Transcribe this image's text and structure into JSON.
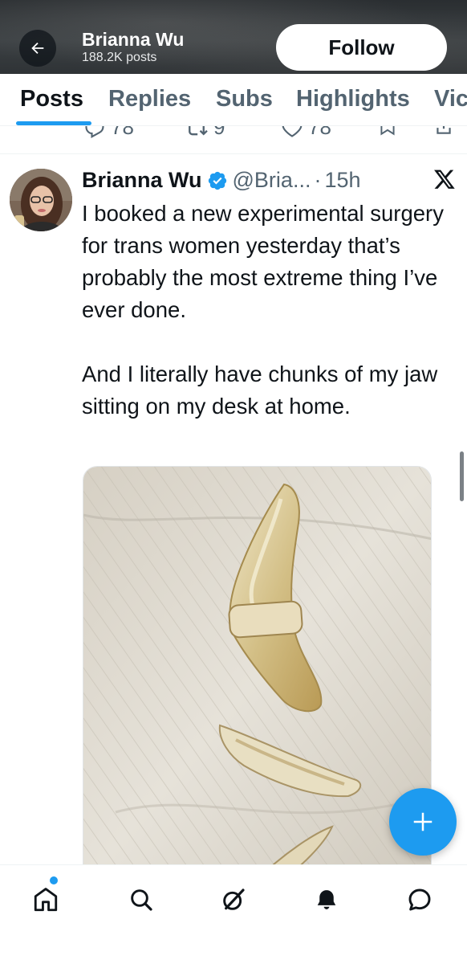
{
  "header": {
    "name": "Brianna Wu",
    "posts_count": "188.2K posts",
    "follow_label": "Follow"
  },
  "tabs": [
    {
      "label": "Posts",
      "active": true
    },
    {
      "label": "Replies",
      "active": false
    },
    {
      "label": "Subs",
      "active": false
    },
    {
      "label": "Highlights",
      "active": false
    },
    {
      "label": "Vic",
      "active": false
    }
  ],
  "prev_tweet_actions": {
    "replies": "78",
    "reposts": "9",
    "likes": "78"
  },
  "tweet": {
    "author_name": "Brianna Wu",
    "verified": true,
    "handle": "@Bria...",
    "separator": "·",
    "time": "15h",
    "text": "I booked a new experimental surgery for trans women yesterday that’s probably the most extreme thing I’ve ever done.\n\nAnd I literally have chunks of my jaw sitting on my desk at home.",
    "media_alt": "photo"
  },
  "colors": {
    "accent": "#1d9bf0",
    "text_primary": "#0f1419",
    "text_secondary": "#536471"
  },
  "icons": {
    "back": "arrow-left-icon",
    "fab": "plus-icon",
    "nav": [
      "home-icon",
      "search-icon",
      "grok-icon",
      "notifications-icon",
      "messages-icon"
    ]
  }
}
